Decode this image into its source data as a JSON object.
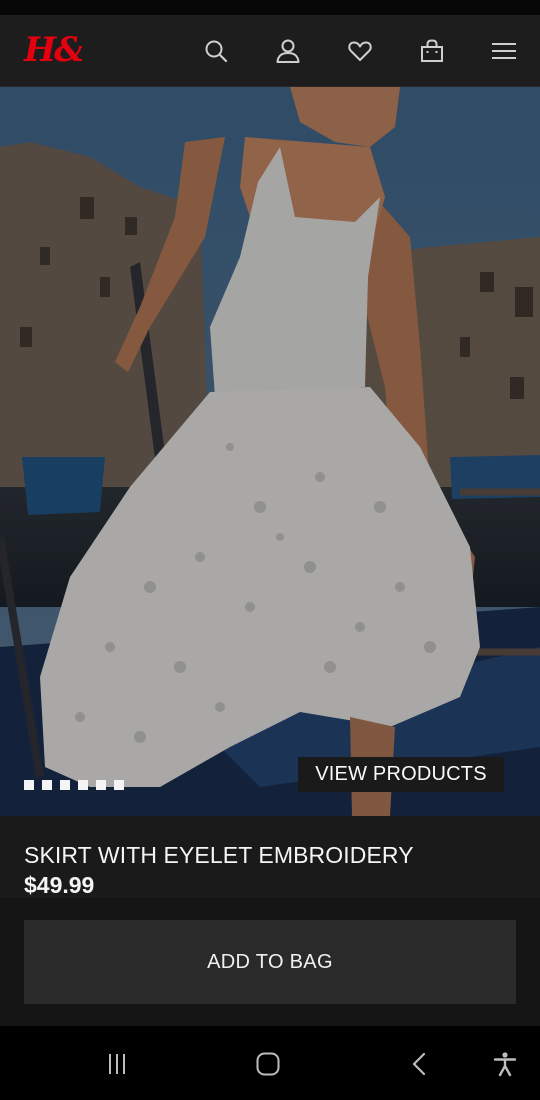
{
  "header": {
    "logo_text": "H&M",
    "brand_color": "#e50010",
    "icons": [
      "search-icon",
      "account-icon",
      "favorites-heart-icon",
      "shopping-bag-icon",
      "menu-icon"
    ]
  },
  "hero": {
    "view_products_label": "VIEW PRODUCTS",
    "carousel": {
      "slide_count": 6
    }
  },
  "product": {
    "name": "SKIRT WITH EYELET EMBROIDERY",
    "price": "$49.99"
  },
  "actions": {
    "add_to_bag_label": "ADD TO BAG"
  },
  "system_nav": {
    "icons": [
      "recent-apps-icon",
      "home-icon",
      "back-icon",
      "accessibility-icon"
    ]
  }
}
